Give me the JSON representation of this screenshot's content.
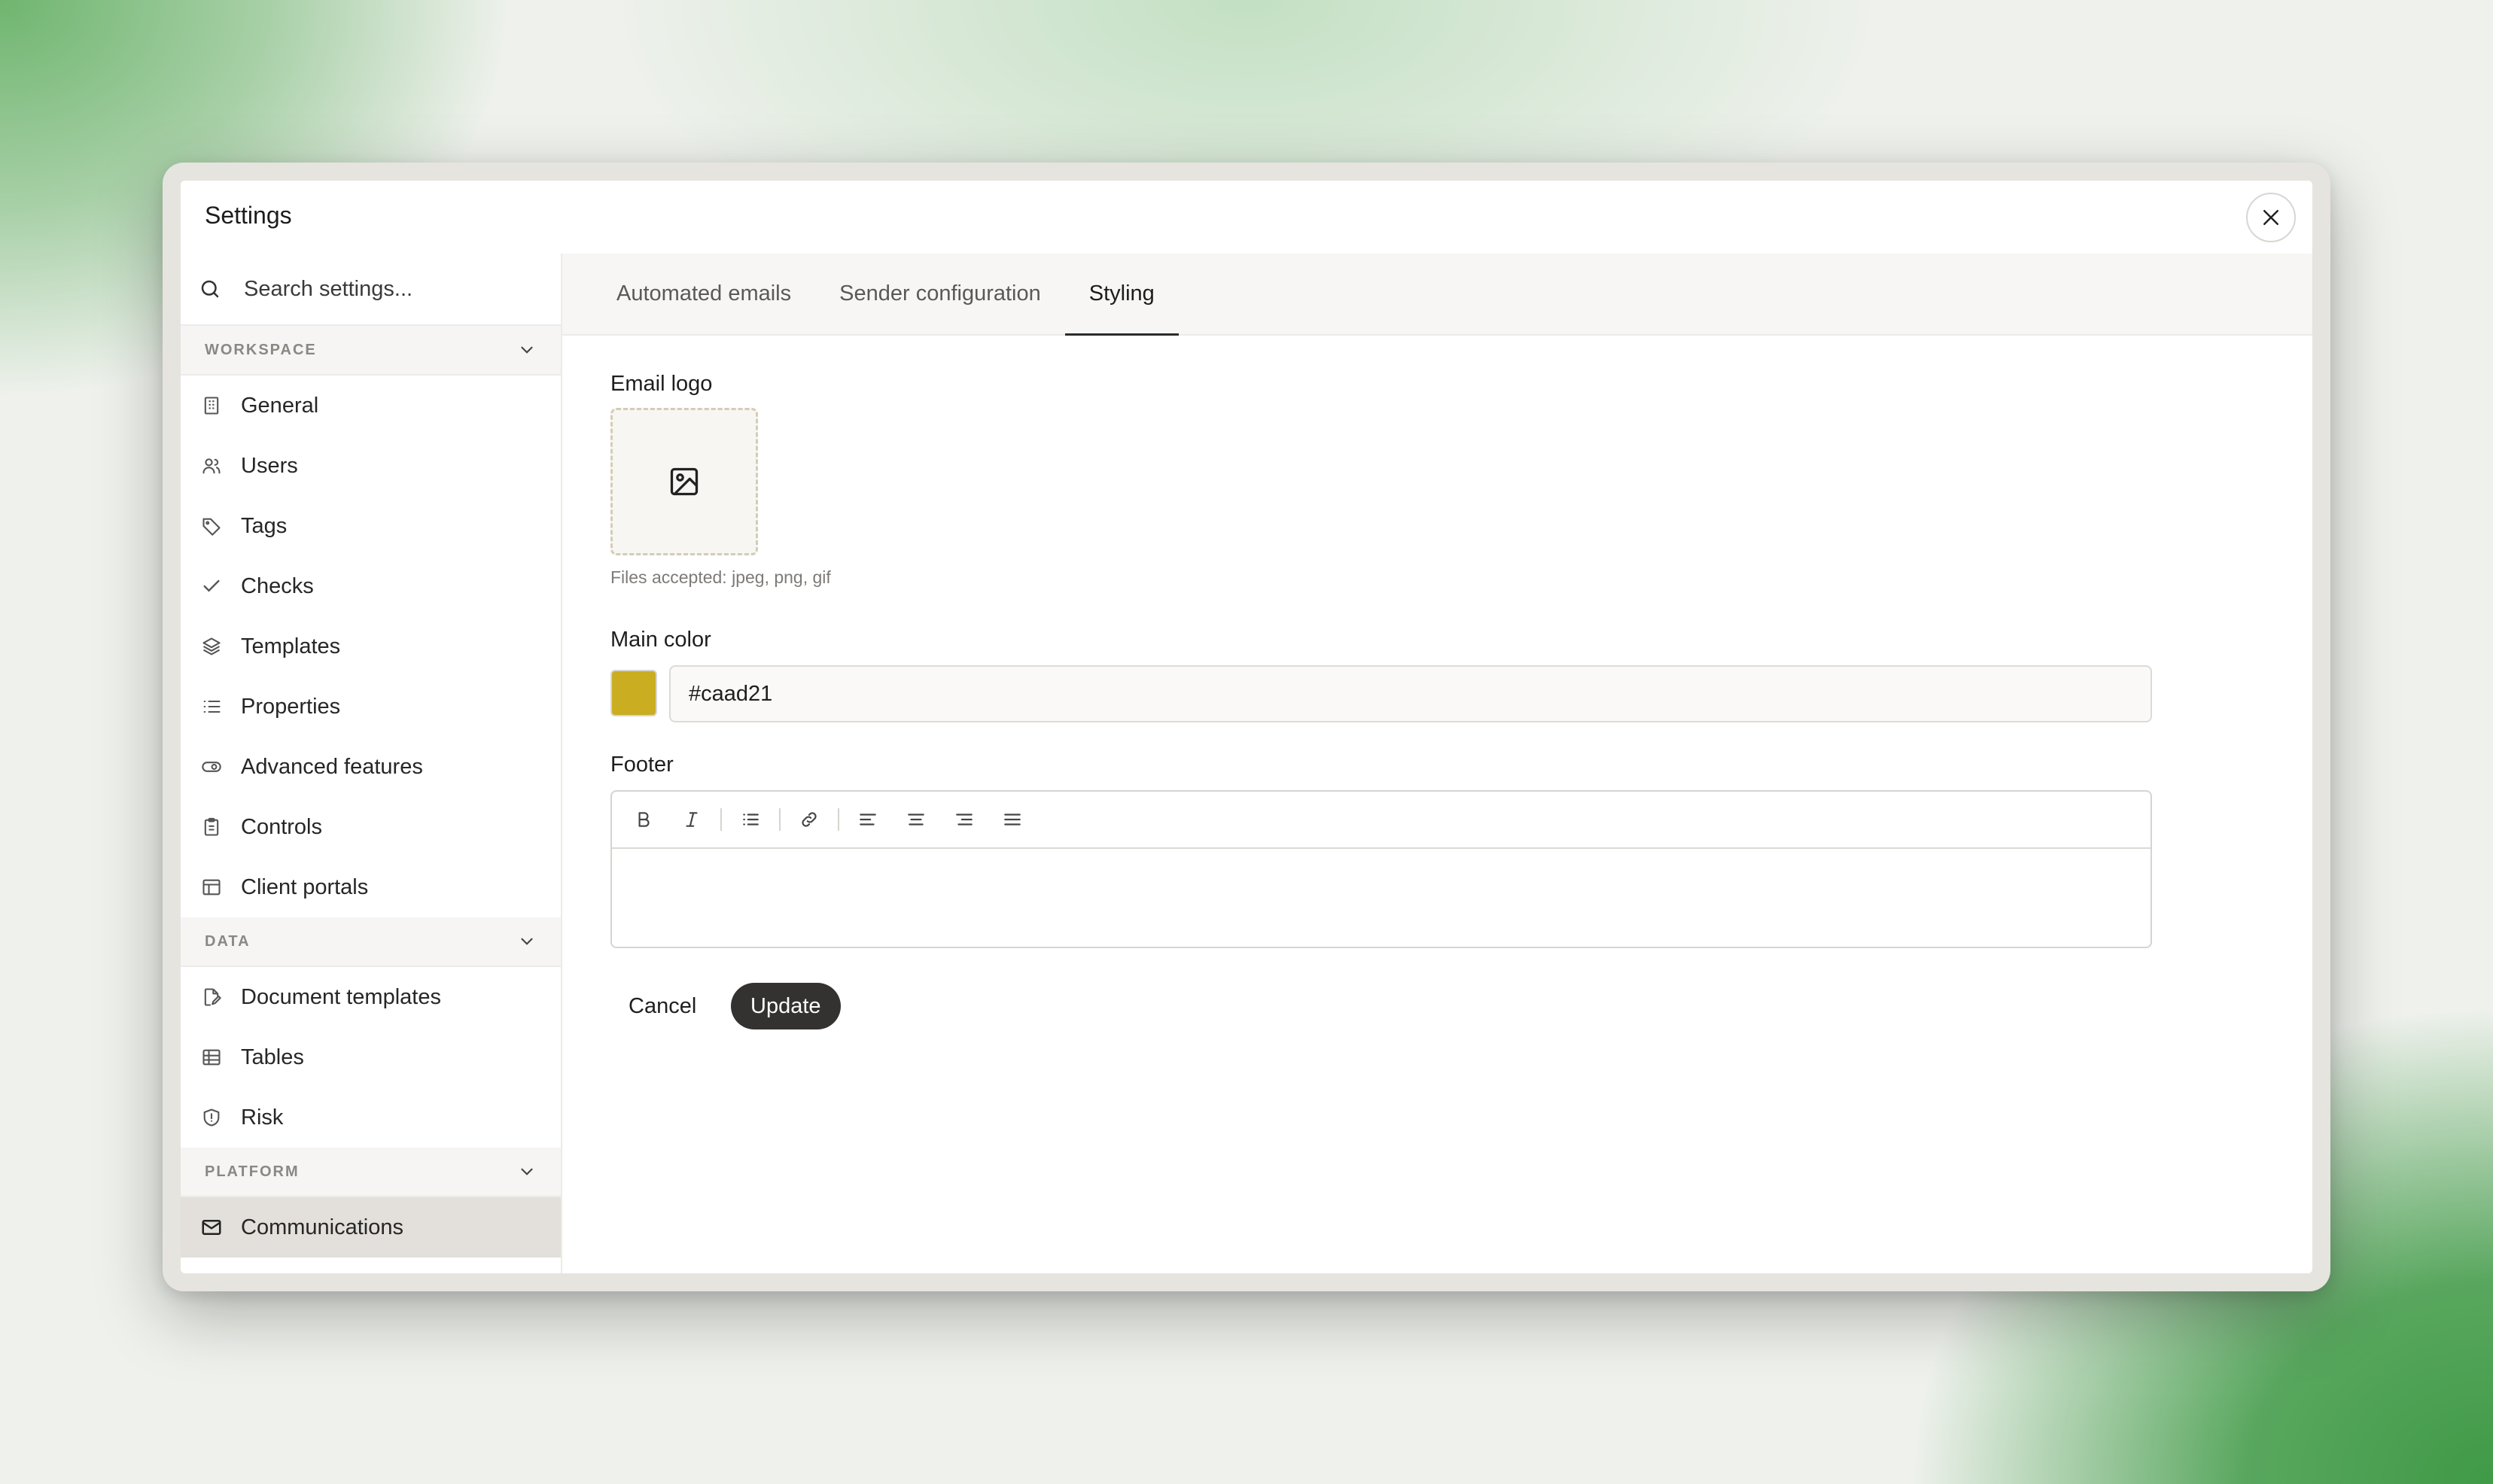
{
  "window": {
    "title": "Settings"
  },
  "sidebar": {
    "search_placeholder": "Search settings...",
    "sections": [
      {
        "label": "WORKSPACE",
        "items": [
          {
            "label": "General",
            "icon": "building-icon"
          },
          {
            "label": "Users",
            "icon": "users-icon"
          },
          {
            "label": "Tags",
            "icon": "tag-icon"
          },
          {
            "label": "Checks",
            "icon": "check-icon"
          },
          {
            "label": "Templates",
            "icon": "layers-icon"
          },
          {
            "label": "Properties",
            "icon": "list-icon"
          },
          {
            "label": "Advanced features",
            "icon": "toggle-icon"
          },
          {
            "label": "Controls",
            "icon": "clipboard-icon"
          },
          {
            "label": "Client portals",
            "icon": "layout-icon"
          }
        ]
      },
      {
        "label": "DATA",
        "items": [
          {
            "label": "Document templates",
            "icon": "file-edit-icon"
          },
          {
            "label": "Tables",
            "icon": "table-icon"
          },
          {
            "label": "Risk",
            "icon": "shield-icon"
          }
        ]
      },
      {
        "label": "PLATFORM",
        "items": [
          {
            "label": "Communications",
            "icon": "mail-icon",
            "active": true
          }
        ]
      }
    ]
  },
  "tabs": [
    {
      "label": "Automated emails",
      "active": false
    },
    {
      "label": "Sender configuration",
      "active": false
    },
    {
      "label": "Styling",
      "active": true
    }
  ],
  "form": {
    "email_logo_label": "Email logo",
    "files_hint": "Files accepted: jpeg, png, gif",
    "main_color_label": "Main color",
    "main_color_value": "#caad21",
    "footer_label": "Footer",
    "toolbar": [
      "bold-icon",
      "italic-icon",
      "bullet-list-icon",
      "link-icon",
      "align-left-icon",
      "align-center-icon",
      "align-right-icon",
      "align-justify-icon"
    ],
    "footer_value": ""
  },
  "actions": {
    "cancel_label": "Cancel",
    "update_label": "Update"
  },
  "colors": {
    "accent": "#caad21",
    "button_dark": "#333231",
    "active_item_bg": "#e3dfdb"
  }
}
